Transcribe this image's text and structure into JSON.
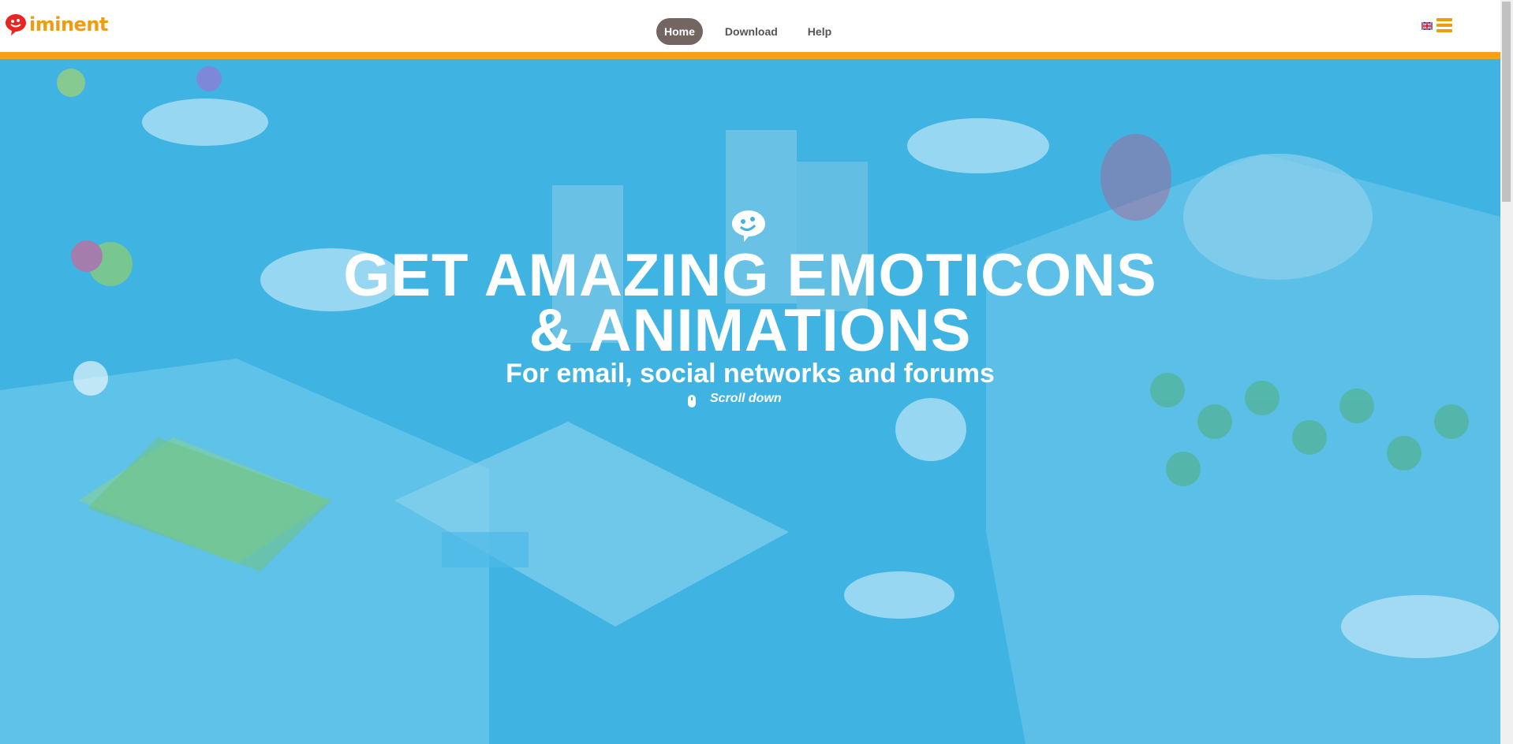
{
  "header": {
    "logo_text": "iminent",
    "nav": [
      {
        "label": "Home",
        "active": true
      },
      {
        "label": "Download",
        "active": false
      },
      {
        "label": "Help",
        "active": false
      }
    ],
    "language_icon": "uk-flag-icon",
    "menu_icon": "hamburger-menu-icon"
  },
  "hero": {
    "icon": "speech-bubble-smiley-icon",
    "headline_line1": "GET AMAZING EMOTICONS",
    "headline_line2": "& ANIMATIONS",
    "subline": "For email, social networks and forums",
    "scroll_label": "Scroll down",
    "scroll_icon": "mouse-icon"
  },
  "colors": {
    "accent_orange": "#f5a21a",
    "hero_blue": "#3fb4e3",
    "nav_active_bg": "#736562",
    "logo_red": "#e8261f"
  }
}
